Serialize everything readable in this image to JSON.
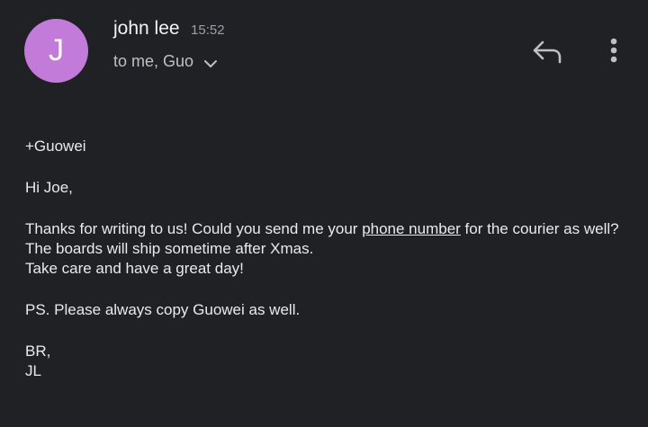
{
  "header": {
    "avatar_letter": "J",
    "avatar_color": "#c27bd8",
    "sender_name": "john lee",
    "time": "15:52",
    "recipients": "to me, Guo",
    "icons": {
      "chevron": "chevron-down-icon",
      "reply": "reply-icon",
      "more": "more-vert-icon"
    }
  },
  "message": {
    "cc_line": "+Guowei",
    "greeting": "Hi Joe,",
    "para1_part1": "Thanks for writing to us! Could you send me your ",
    "para1_link": "phone number",
    "para1_part2": " for the courier as well?",
    "line_ship": "The boards will ship sometime after Xmas.",
    "line_care": "Take care and have a great day!",
    "ps": "PS. Please always copy Guowei as well.",
    "signoff": "BR,",
    "initials": "JL"
  },
  "colors": {
    "background": "#202124",
    "text": "#e8eaed",
    "secondary_text": "#9aa0a6"
  }
}
